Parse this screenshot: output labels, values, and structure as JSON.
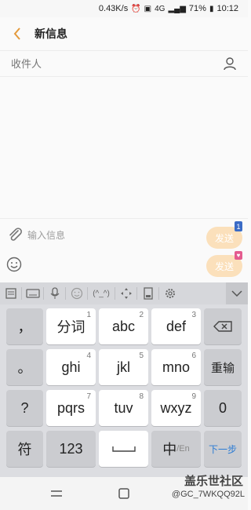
{
  "status_bar": {
    "speed": "0.43K/s",
    "signal": "4G",
    "battery": "71%",
    "time": "10:12"
  },
  "app_bar": {
    "title": "新信息"
  },
  "recipient": {
    "placeholder": "收件人"
  },
  "compose": {
    "placeholder": "输入信息",
    "send_label_1": "发送",
    "send_label_2": "发送",
    "sim_number": "1"
  },
  "toolbar": {
    "emoticon_label": "(^_^)"
  },
  "keyboard": {
    "row1": [
      {
        "label": "，",
        "num": ""
      },
      {
        "label": "分词",
        "num": "1"
      },
      {
        "label": "abc",
        "num": "2"
      },
      {
        "label": "def",
        "num": "3"
      },
      {
        "label": "⌫",
        "num": ""
      }
    ],
    "row2": [
      {
        "label": "。",
        "num": ""
      },
      {
        "label": "ghi",
        "num": "4"
      },
      {
        "label": "jkl",
        "num": "5"
      },
      {
        "label": "mno",
        "num": "6"
      },
      {
        "label": "重输",
        "num": ""
      }
    ],
    "row3": [
      {
        "label": "?",
        "num": ""
      },
      {
        "label": "pqrs",
        "num": "7"
      },
      {
        "label": "tuv",
        "num": "8"
      },
      {
        "label": "wxyz",
        "num": "9"
      },
      {
        "label": "0",
        "num": ""
      }
    ],
    "row4": {
      "symbol": "符",
      "numeric": "123",
      "lang_main": "中",
      "lang_sub": "/En",
      "next": "下一步"
    }
  },
  "watermark": {
    "main": "盖乐世社区",
    "sub": "@GC_7WKQQ92L"
  },
  "colors": {
    "accent": "#e49a3c",
    "send_bg": "#fbe0bb",
    "next_blue": "#2a7bd4"
  }
}
